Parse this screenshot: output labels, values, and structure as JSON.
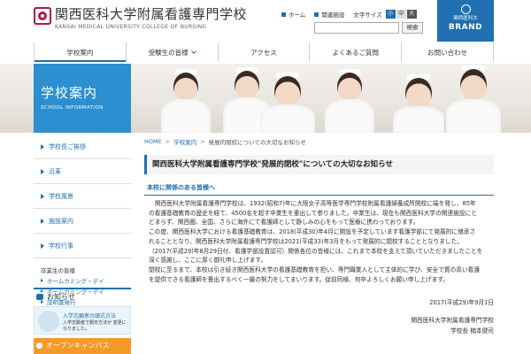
{
  "header": {
    "logo_jp": "関西医科大学附属看護専門学校",
    "logo_en": "KANSAI MEDICAL UNIVERSITY COLLEGE OF NURSING",
    "home_label": "ホーム",
    "links_label": "関連施設",
    "font_size_label": "文字サイズ",
    "font_sizes": [
      "小",
      "中",
      "大"
    ],
    "search_placeholder": "",
    "search_button": "検索",
    "brand_sub": "関西医科大",
    "brand_title": "BRAND"
  },
  "gnav": [
    {
      "label": "学校案内"
    },
    {
      "label": "受験生の皆様"
    },
    {
      "label": "アクセス"
    },
    {
      "label": "よくあるご質問"
    },
    {
      "label": "お問い合わせ"
    }
  ],
  "hero": {
    "title": "学校案内",
    "subtitle": "SCHOOL INFORMATION"
  },
  "sidebar": {
    "items": [
      {
        "label": "学校長ご挨拶"
      },
      {
        "label": "沿革"
      },
      {
        "label": "学校風景"
      },
      {
        "label": "施設案内"
      },
      {
        "label": "学校行事"
      }
    ],
    "group_label": "卒業生の皆様",
    "sub_items": [
      {
        "label": "ホームカミング・デイ"
      },
      {
        "label": "ホームカミング・デイ"
      },
      {
        "label": "証明書発行"
      }
    ],
    "news_title": "お知らせ",
    "banner1_title": "入学志願者の頭式方法",
    "banner1_text": "入学志願者で願天方法が\n変更になりました。",
    "banner2_title": "オープンキャンパス"
  },
  "breadcrumb": {
    "home": "HOME",
    "section": "学校案内",
    "current": "発展的閉校についての大切なお知らせ"
  },
  "main": {
    "title": "関西医科大学附属看護専門学校\"発展的閉校\"についての大切なお知らせ",
    "section_heading": "本校に関係のある皆様へ",
    "paragraph_lines": [
      "関西医科大学附属看護専門学校は、1932(昭和7)年に大阪女子高等医学専門学校附属看護婦養成所開校に端を発し、85年",
      "の看護基礎教育の歴史を経て、4500名を超す卒業生を輩出して参りました。卒業生は、現在も関西医科大学の関連施設にと",
      "どまらず、関西圏、全国、さらに海外にて看護師として静しみの心をもって医療に携わっております。",
      "この度、関西医科大学における看護基礎教育は、2018(平成30)年4月に開設を予定しています看護学部にて発展的に継承さ",
      "れることとなり、関西医科大学附属看護専門学校は2021(平成33)年3月をもって発展的に閉校することとなりました。",
      "（2017(平成29)年8月29日付、看護学部設置認可）関係各位の皆様には、これまで本校を支えて頂いていただきましたことを",
      "深く感謝し、ここに厚く御礼申し上げます。",
      "閉校に至るまで、本校は引き続き関西医科大学の看護基礎教育を担い、専門職業人として主体的に学び、安全で質の高い看護",
      "を提供できる看護師を輩出するべく一層の努力をしてまいります。従前同様、何卒よろしくお願い申し上げます。"
    ],
    "date": "2017(平成29)年9月1日",
    "org": "関西医科大学附属看護専門学校",
    "principal": "学校長 楠本健司"
  }
}
